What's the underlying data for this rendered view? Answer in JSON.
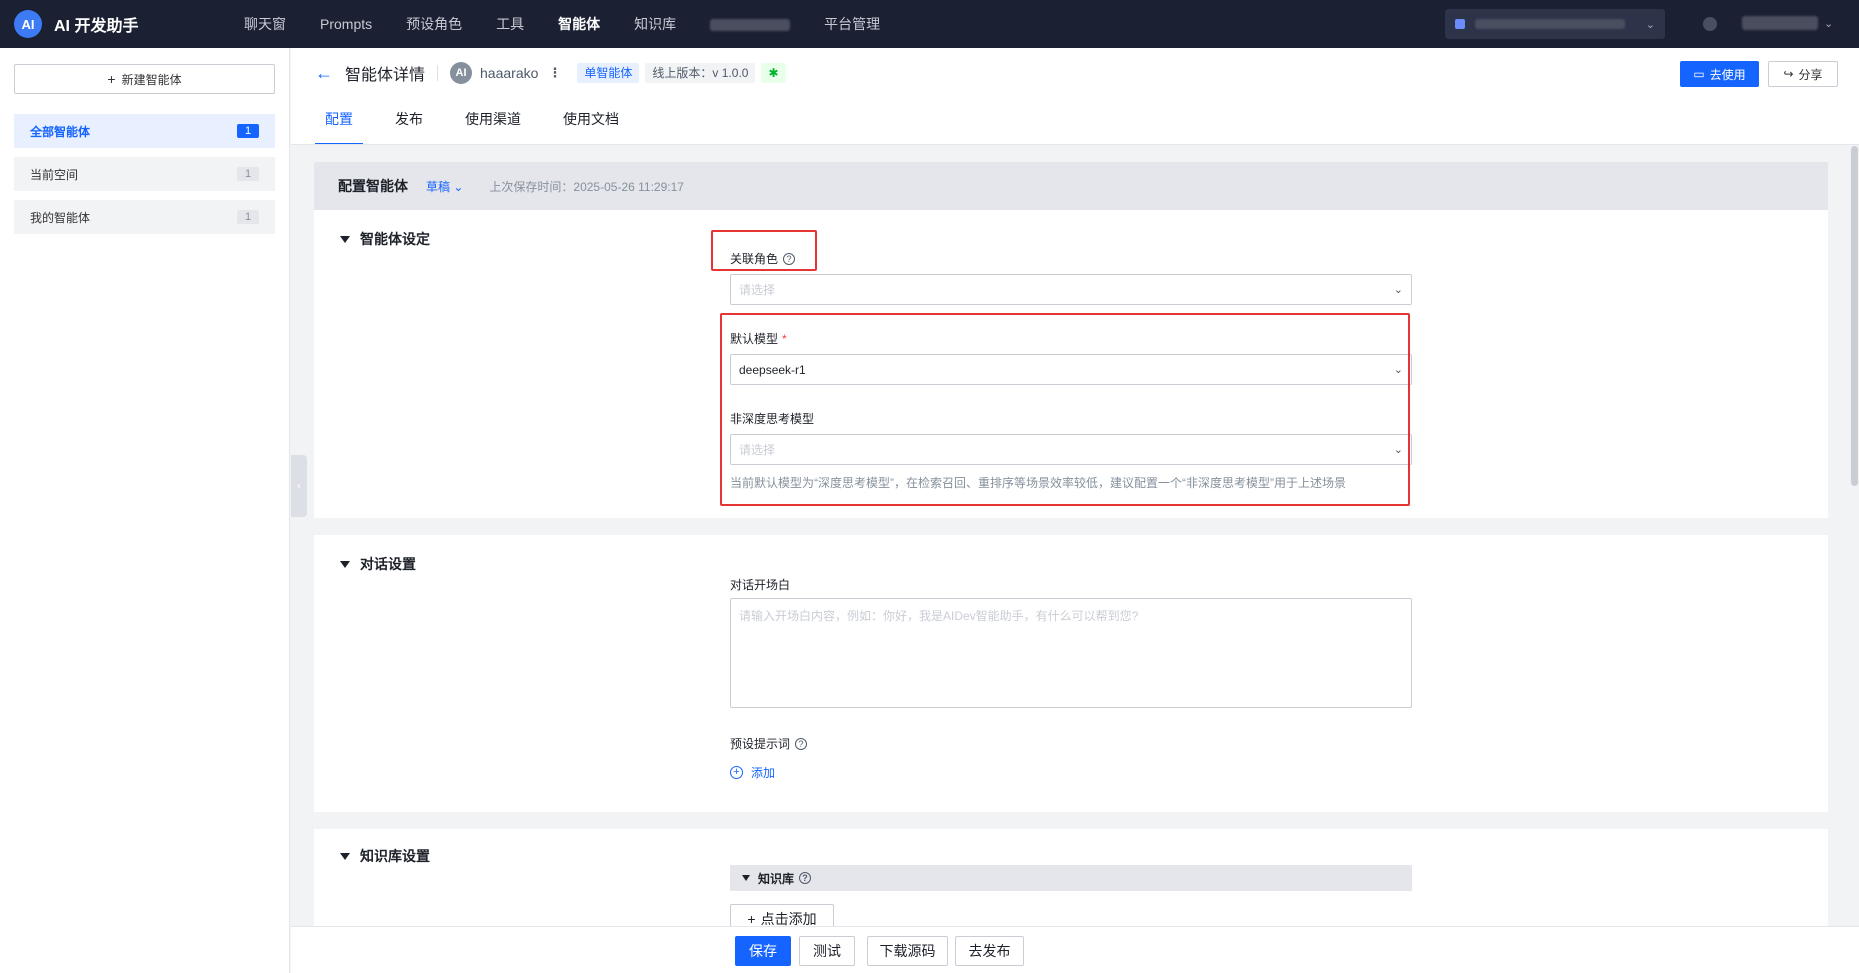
{
  "topbar": {
    "brand_logo": "AI",
    "brand_name": "AI 开发助手",
    "nav": [
      "聊天窗",
      "Prompts",
      "预设角色",
      "工具",
      "智能体",
      "知识库",
      "",
      "平台管理"
    ],
    "active_nav": "智能体",
    "icons": {
      "workspace": "cube-icon",
      "help": "help-icon",
      "dropdown": "chevron-down-icon"
    }
  },
  "sidebar": {
    "new_button": "新建智能体",
    "items": [
      {
        "label": "全部智能体",
        "count": "1",
        "active": true
      },
      {
        "label": "当前空间",
        "count": "1",
        "active": false
      },
      {
        "label": "我的智能体",
        "count": "1",
        "active": false
      }
    ]
  },
  "header": {
    "title": "智能体详情",
    "avatar": "AI",
    "agent_name": "haaarako",
    "tag_type": "单智能体",
    "tag_version": "线上版本：v 1.0.0",
    "tag_status": "✱",
    "use_button": "去使用",
    "share_button": "分享",
    "tabs": [
      "配置",
      "发布",
      "使用渠道",
      "使用文档"
    ],
    "active_tab": "配置"
  },
  "config": {
    "title": "配置智能体",
    "status": "草稿",
    "last_saved": "上次保存时间：2025-05-26 11:29:17"
  },
  "agent_settings": {
    "title": "智能体设定",
    "role_label": "关联角色",
    "role_placeholder": "请选择",
    "model_label": "默认模型",
    "model_required": "*",
    "model_value": "deepseek-r1",
    "nonthink_label": "非深度思考模型",
    "nonthink_placeholder": "请选择",
    "hint": "当前默认模型为“深度思考模型”，在检索召回、重排序等场景效率较低，建议配置一个“非深度思考模型”用于上述场景"
  },
  "dialog_settings": {
    "title": "对话设置",
    "opening_label": "对话开场白",
    "opening_placeholder": "请输入开场白内容，例如：你好，我是AIDev智能助手，有什么可以帮到您?",
    "preset_label": "预设提示词",
    "add_label": "添加"
  },
  "kb_settings": {
    "title": "知识库设置",
    "kb_label": "知识库",
    "click_add": "点击添加"
  },
  "actions": {
    "save": "保存",
    "test": "测试",
    "download": "下载源码",
    "publish": "去发布"
  },
  "colors": {
    "primary": "#1664ff",
    "topbar": "#1b2033",
    "highlight_box": "#e63334",
    "required": "#f53f3f"
  }
}
